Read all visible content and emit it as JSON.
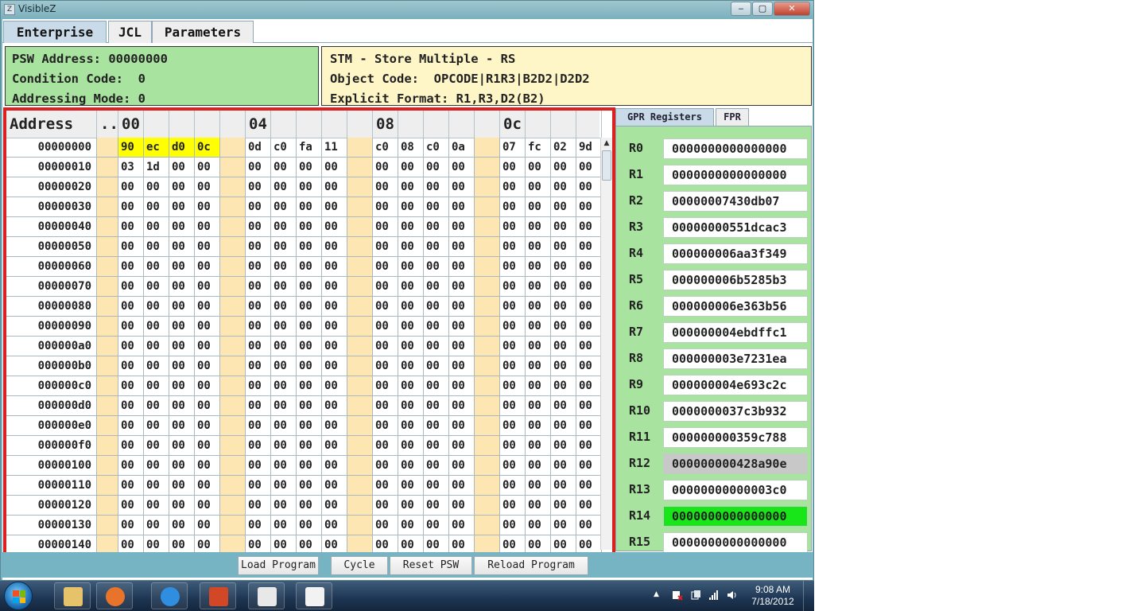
{
  "window": {
    "title": "VisibleZ",
    "minimize_label": "‒",
    "maximize_label": "▢",
    "close_label": "✕",
    "icon_name": "app-icon"
  },
  "tabs": [
    {
      "label": "Enterprise",
      "active": true
    },
    {
      "label": "JCL",
      "active": false
    },
    {
      "label": "Parameters",
      "active": false
    }
  ],
  "psw": {
    "address": "PSW Address: 00000000",
    "condition_code": "Condition Code:  0",
    "addressing_mode": "Addressing Mode: 0"
  },
  "instruction": {
    "name": "STM - Store Multiple - RS",
    "object_code": "Object Code:  OPCODE|R1R3|B2D2|D2D2",
    "explicit_format": "Explicit Format: R1,R3,D2(B2)"
  },
  "memory": {
    "header": {
      "address": "Address",
      "dots": "..",
      "offsets": [
        "00",
        "04",
        "08",
        "0c"
      ]
    },
    "rows": [
      {
        "addr": "00000000",
        "bytes": [
          "90",
          "ec",
          "d0",
          "0c",
          "0d",
          "c0",
          "fa",
          "11",
          "c0",
          "08",
          "c0",
          "0a",
          "07",
          "fc",
          "02",
          "9d"
        ],
        "highlight": [
          0,
          1,
          2,
          3
        ]
      },
      {
        "addr": "00000010",
        "bytes": [
          "03",
          "1d",
          "00",
          "00",
          "00",
          "00",
          "00",
          "00",
          "00",
          "00",
          "00",
          "00",
          "00",
          "00",
          "00",
          "00"
        ],
        "highlight": []
      },
      {
        "addr": "00000020",
        "bytes": [
          "00",
          "00",
          "00",
          "00",
          "00",
          "00",
          "00",
          "00",
          "00",
          "00",
          "00",
          "00",
          "00",
          "00",
          "00",
          "00"
        ],
        "highlight": []
      },
      {
        "addr": "00000030",
        "bytes": [
          "00",
          "00",
          "00",
          "00",
          "00",
          "00",
          "00",
          "00",
          "00",
          "00",
          "00",
          "00",
          "00",
          "00",
          "00",
          "00"
        ],
        "highlight": []
      },
      {
        "addr": "00000040",
        "bytes": [
          "00",
          "00",
          "00",
          "00",
          "00",
          "00",
          "00",
          "00",
          "00",
          "00",
          "00",
          "00",
          "00",
          "00",
          "00",
          "00"
        ],
        "highlight": []
      },
      {
        "addr": "00000050",
        "bytes": [
          "00",
          "00",
          "00",
          "00",
          "00",
          "00",
          "00",
          "00",
          "00",
          "00",
          "00",
          "00",
          "00",
          "00",
          "00",
          "00"
        ],
        "highlight": []
      },
      {
        "addr": "00000060",
        "bytes": [
          "00",
          "00",
          "00",
          "00",
          "00",
          "00",
          "00",
          "00",
          "00",
          "00",
          "00",
          "00",
          "00",
          "00",
          "00",
          "00"
        ],
        "highlight": []
      },
      {
        "addr": "00000070",
        "bytes": [
          "00",
          "00",
          "00",
          "00",
          "00",
          "00",
          "00",
          "00",
          "00",
          "00",
          "00",
          "00",
          "00",
          "00",
          "00",
          "00"
        ],
        "highlight": []
      },
      {
        "addr": "00000080",
        "bytes": [
          "00",
          "00",
          "00",
          "00",
          "00",
          "00",
          "00",
          "00",
          "00",
          "00",
          "00",
          "00",
          "00",
          "00",
          "00",
          "00"
        ],
        "highlight": []
      },
      {
        "addr": "00000090",
        "bytes": [
          "00",
          "00",
          "00",
          "00",
          "00",
          "00",
          "00",
          "00",
          "00",
          "00",
          "00",
          "00",
          "00",
          "00",
          "00",
          "00"
        ],
        "highlight": []
      },
      {
        "addr": "000000a0",
        "bytes": [
          "00",
          "00",
          "00",
          "00",
          "00",
          "00",
          "00",
          "00",
          "00",
          "00",
          "00",
          "00",
          "00",
          "00",
          "00",
          "00"
        ],
        "highlight": []
      },
      {
        "addr": "000000b0",
        "bytes": [
          "00",
          "00",
          "00",
          "00",
          "00",
          "00",
          "00",
          "00",
          "00",
          "00",
          "00",
          "00",
          "00",
          "00",
          "00",
          "00"
        ],
        "highlight": []
      },
      {
        "addr": "000000c0",
        "bytes": [
          "00",
          "00",
          "00",
          "00",
          "00",
          "00",
          "00",
          "00",
          "00",
          "00",
          "00",
          "00",
          "00",
          "00",
          "00",
          "00"
        ],
        "highlight": []
      },
      {
        "addr": "000000d0",
        "bytes": [
          "00",
          "00",
          "00",
          "00",
          "00",
          "00",
          "00",
          "00",
          "00",
          "00",
          "00",
          "00",
          "00",
          "00",
          "00",
          "00"
        ],
        "highlight": []
      },
      {
        "addr": "000000e0",
        "bytes": [
          "00",
          "00",
          "00",
          "00",
          "00",
          "00",
          "00",
          "00",
          "00",
          "00",
          "00",
          "00",
          "00",
          "00",
          "00",
          "00"
        ],
        "highlight": []
      },
      {
        "addr": "000000f0",
        "bytes": [
          "00",
          "00",
          "00",
          "00",
          "00",
          "00",
          "00",
          "00",
          "00",
          "00",
          "00",
          "00",
          "00",
          "00",
          "00",
          "00"
        ],
        "highlight": []
      },
      {
        "addr": "00000100",
        "bytes": [
          "00",
          "00",
          "00",
          "00",
          "00",
          "00",
          "00",
          "00",
          "00",
          "00",
          "00",
          "00",
          "00",
          "00",
          "00",
          "00"
        ],
        "highlight": []
      },
      {
        "addr": "00000110",
        "bytes": [
          "00",
          "00",
          "00",
          "00",
          "00",
          "00",
          "00",
          "00",
          "00",
          "00",
          "00",
          "00",
          "00",
          "00",
          "00",
          "00"
        ],
        "highlight": []
      },
      {
        "addr": "00000120",
        "bytes": [
          "00",
          "00",
          "00",
          "00",
          "00",
          "00",
          "00",
          "00",
          "00",
          "00",
          "00",
          "00",
          "00",
          "00",
          "00",
          "00"
        ],
        "highlight": []
      },
      {
        "addr": "00000130",
        "bytes": [
          "00",
          "00",
          "00",
          "00",
          "00",
          "00",
          "00",
          "00",
          "00",
          "00",
          "00",
          "00",
          "00",
          "00",
          "00",
          "00"
        ],
        "highlight": []
      },
      {
        "addr": "00000140",
        "bytes": [
          "00",
          "00",
          "00",
          "00",
          "00",
          "00",
          "00",
          "00",
          "00",
          "00",
          "00",
          "00",
          "00",
          "00",
          "00",
          "00"
        ],
        "highlight": []
      }
    ]
  },
  "register_tabs": [
    {
      "label": "GPR Registers",
      "active": true
    },
    {
      "label": "FPR",
      "active": false
    }
  ],
  "registers": [
    {
      "name": "R0",
      "value": "0000000000000000",
      "bg": "#ffffff"
    },
    {
      "name": "R1",
      "value": "0000000000000000",
      "bg": "#ffffff"
    },
    {
      "name": "R2",
      "value": "00000007430db07",
      "bg": "#ffffff"
    },
    {
      "name": "R3",
      "value": "00000000551dcac3",
      "bg": "#ffffff"
    },
    {
      "name": "R4",
      "value": "000000006aa3f349",
      "bg": "#ffffff"
    },
    {
      "name": "R5",
      "value": "000000006b5285b3",
      "bg": "#ffffff"
    },
    {
      "name": "R6",
      "value": "000000006e363b56",
      "bg": "#ffffff"
    },
    {
      "name": "R7",
      "value": "000000004ebdffc1",
      "bg": "#ffffff"
    },
    {
      "name": "R8",
      "value": "000000003e7231ea",
      "bg": "#ffffff"
    },
    {
      "name": "R9",
      "value": "000000004e693c2c",
      "bg": "#ffffff"
    },
    {
      "name": "R10",
      "value": "0000000037c3b932",
      "bg": "#ffffff"
    },
    {
      "name": "R11",
      "value": "000000000359c788",
      "bg": "#ffffff"
    },
    {
      "name": "R12",
      "value": "000000000428a90e",
      "bg": "#c8c8c8"
    },
    {
      "name": "R13",
      "value": "00000000000003c0",
      "bg": "#ffffff"
    },
    {
      "name": "R14",
      "value": "0000000000000000",
      "bg": "#19e619"
    },
    {
      "name": "R15",
      "value": "0000000000000000",
      "bg": "#ffffff"
    }
  ],
  "actions": {
    "load_program": "Load Program",
    "cycle": "Cycle",
    "reset_psw": "Reset PSW",
    "reload_program": "Reload Program"
  },
  "taskbar": {
    "apps": [
      {
        "icon": "folder-icon",
        "color": "#e6c36a"
      },
      {
        "icon": "firefox-icon",
        "color": "#e8742b"
      },
      {
        "icon": "internet-explorer-icon",
        "color": "#2f8ee0"
      },
      {
        "icon": "powerpoint-icon",
        "color": "#d24726"
      },
      {
        "icon": "bird-app-icon",
        "color": "#e8e8e8"
      },
      {
        "icon": "java-icon",
        "color": "#f2f2f2"
      }
    ],
    "tray_arrow": "▲",
    "clock_time": "9:08 AM",
    "clock_date": "7/18/2012"
  },
  "colors": {
    "highlight_byte": "#ffff00",
    "separator_column": "#fde6b1",
    "psw_panel": "#a9e3a0",
    "instruction_panel": "#fff6c8",
    "memory_border": "#dd2020"
  }
}
